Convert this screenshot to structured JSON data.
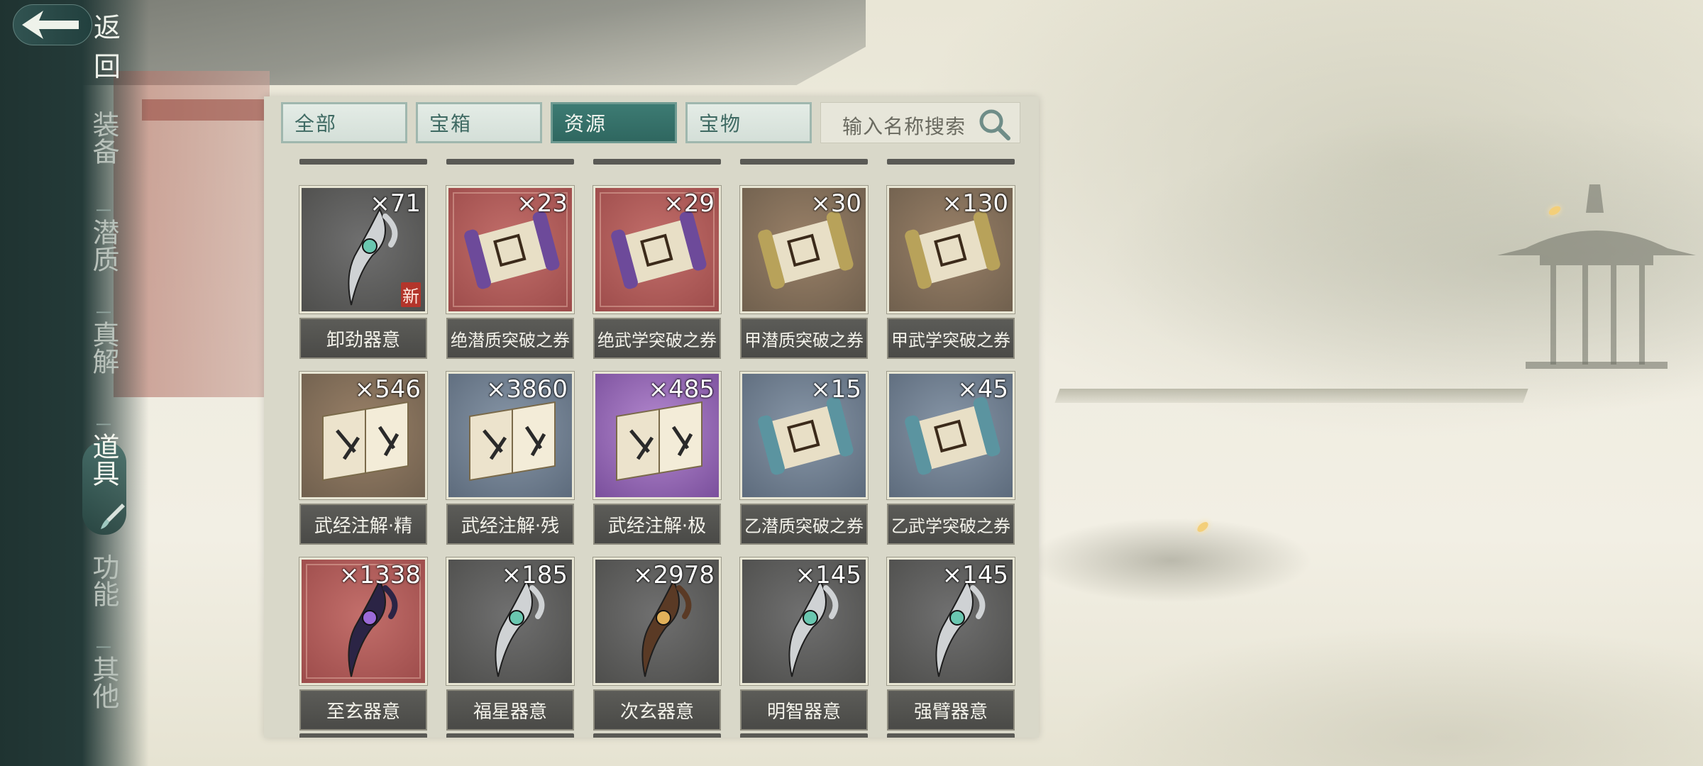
{
  "header": {
    "back_label": "返回"
  },
  "sidebar": {
    "items": [
      {
        "label": "装备",
        "active": false
      },
      {
        "label": "潜质",
        "active": false
      },
      {
        "label": "真解",
        "active": false
      },
      {
        "label": "道具",
        "active": true
      },
      {
        "label": "功能",
        "active": false
      },
      {
        "label": "其他",
        "active": false
      }
    ]
  },
  "tabs": [
    {
      "label": "全部",
      "active": false
    },
    {
      "label": "宝箱",
      "active": false
    },
    {
      "label": "资源",
      "active": true
    },
    {
      "label": "宝物",
      "active": false
    }
  ],
  "search": {
    "placeholder": "输入名称搜索"
  },
  "items": [
    {
      "name": "卸劲器意",
      "qty": "×71",
      "rarity": "gray",
      "icon": "blade-charm-icon",
      "new_badge": "新"
    },
    {
      "name": "绝潜质突破之券",
      "qty": "×23",
      "rarity": "red",
      "icon": "purple-scroll-icon"
    },
    {
      "name": "绝武学突破之券",
      "qty": "×29",
      "rarity": "red",
      "icon": "purple-scroll-icon"
    },
    {
      "name": "甲潜质突破之券",
      "qty": "×30",
      "rarity": "brown",
      "icon": "yellow-scroll-icon"
    },
    {
      "name": "甲武学突破之券",
      "qty": "×130",
      "rarity": "brown",
      "icon": "yellow-scroll-icon"
    },
    {
      "name": "武经注解·精",
      "qty": "×546",
      "rarity": "brown",
      "icon": "open-book-icon"
    },
    {
      "name": "武经注解·残",
      "qty": "×3860",
      "rarity": "blue",
      "icon": "open-book-icon"
    },
    {
      "name": "武经注解·极",
      "qty": "×485",
      "rarity": "purple",
      "icon": "open-book-icon"
    },
    {
      "name": "乙潜质突破之券",
      "qty": "×15",
      "rarity": "blue",
      "icon": "teal-scroll-icon"
    },
    {
      "name": "乙武学突破之券",
      "qty": "×45",
      "rarity": "blue",
      "icon": "teal-scroll-icon"
    },
    {
      "name": "至玄器意",
      "qty": "×1338",
      "rarity": "red",
      "icon": "dark-blade-charm-icon"
    },
    {
      "name": "福星器意",
      "qty": "×185",
      "rarity": "gray",
      "icon": "blade-charm-icon"
    },
    {
      "name": "次玄器意",
      "qty": "×2978",
      "rarity": "gray",
      "icon": "bronze-blade-charm-icon"
    },
    {
      "name": "明智器意",
      "qty": "×145",
      "rarity": "gray",
      "icon": "blade-charm-icon"
    },
    {
      "name": "强臂器意",
      "qty": "×145",
      "rarity": "gray",
      "icon": "blade-charm-icon"
    }
  ],
  "colors": {
    "accent": "#2f6760",
    "sidebar": "#1f3331",
    "panel": "#d9d8c9",
    "new_badge": "#b3352b"
  }
}
